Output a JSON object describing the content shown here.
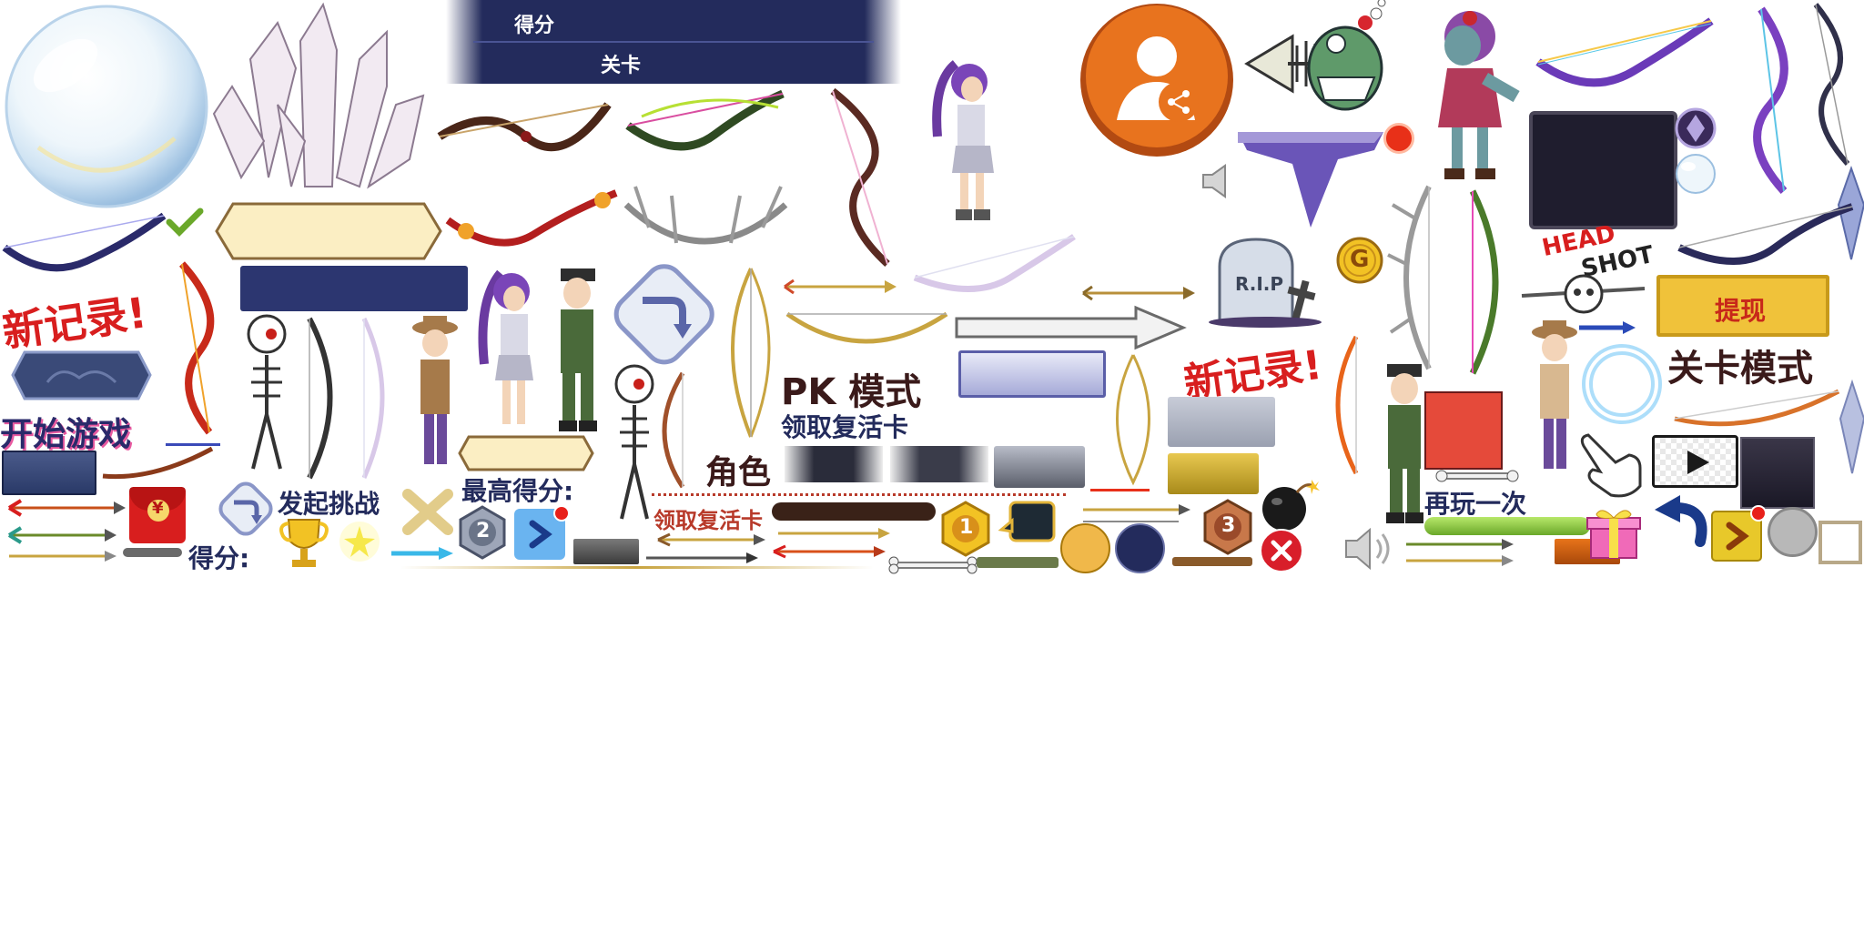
{
  "atlas": {
    "score_label": "得分",
    "level_label": "关卡",
    "new_record": "新记录!",
    "start_game": "开始游戏",
    "challenge": "发起挑战",
    "score_colon": "得分:",
    "high_score": "最高得分:",
    "role": "角色",
    "revive_card": "领取复活卡",
    "revive_card_small": "领取复活卡",
    "pk_mode": "PK 模式",
    "rip": "R.I.P",
    "coin_letter": "G",
    "head": "HEAD",
    "shot": "SHOT",
    "withdraw": "提现",
    "level_mode": "关卡模式",
    "play_again": "再玩一次",
    "red_envelope_symbol": "¥",
    "rank_2": "2",
    "rank_1": "1",
    "rank_3": "3"
  },
  "colors": {
    "navy": "#232b5c",
    "orange": "#e8731e",
    "red": "#d81e1e",
    "gold": "#e2b43a",
    "cream": "#fbeec3",
    "green": "#8bc53f"
  }
}
